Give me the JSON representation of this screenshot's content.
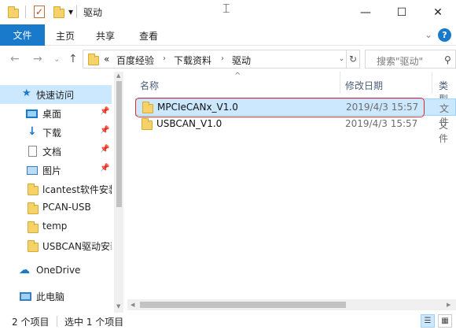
{
  "window": {
    "title": "驱动",
    "controls": {
      "minimize": "—",
      "maximize": "☐",
      "close": "✕"
    },
    "qa_dropdown": "▾",
    "cursor": "⌶"
  },
  "ribbon": {
    "file_tab": "文件",
    "tabs": [
      "主页",
      "共享",
      "查看"
    ],
    "collapse_chevron": "⌄",
    "help": "?"
  },
  "nav": {
    "back": "←",
    "forward": "→",
    "recent": "⌄",
    "up": "↑",
    "breadcrumb_overflow": "«",
    "breadcrumb": [
      "百度经验",
      "下载资料",
      "驱动"
    ],
    "crumb_separator": "›",
    "address_dropdown": "⌄",
    "refresh": "↻",
    "search_placeholder": "搜索\"驱动\"",
    "search_glyph": "⚲"
  },
  "sidebar": {
    "quick_access": "快速访问",
    "items": [
      {
        "label": "桌面",
        "pinned": true
      },
      {
        "label": "下载",
        "pinned": true
      },
      {
        "label": "文档",
        "pinned": true
      },
      {
        "label": "图片",
        "pinned": true
      },
      {
        "label": "lcantest软件安装"
      },
      {
        "label": "PCAN-USB"
      },
      {
        "label": "temp"
      },
      {
        "label": "USBCAN驱动安装"
      }
    ],
    "onedrive": "OneDrive",
    "this_pc": "此电脑",
    "pin_glyph": "📌"
  },
  "filelist": {
    "columns": {
      "name": "名称",
      "date": "修改日期",
      "type": "类型"
    },
    "sort_indicator": "^",
    "rows": [
      {
        "name": "MPCIeCANx_V1.0",
        "date": "2019/4/3 15:57",
        "type": "文件",
        "selected": true
      },
      {
        "name": "USBCAN_V1.0",
        "date": "2019/4/3 15:57",
        "type": "文件",
        "selected": false
      }
    ]
  },
  "status": {
    "count": "2 个项目",
    "selected": "选中 1 个项目"
  },
  "colors": {
    "accent": "#1979ca",
    "selection": "#cce8ff",
    "annotation": "#e32727",
    "folder": "#f6d36a"
  }
}
